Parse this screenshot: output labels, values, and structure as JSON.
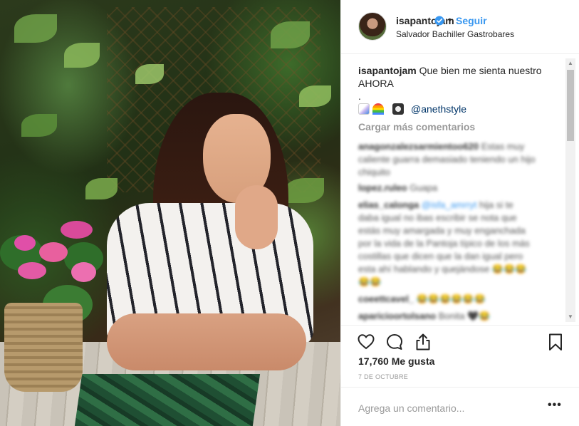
{
  "post": {
    "author": {
      "username": "isapantojam",
      "verified": true,
      "follow_separator": "•",
      "follow_label": "Seguir",
      "location": "Salvador Bachiller Gastrobares"
    },
    "caption": {
      "username": "isapantojam",
      "text": "Que bien me sienta nuestro AHORA",
      "dot": ".",
      "emoji_line": [
        "unicorn-emoji",
        "rainbow-emoji",
        "camera-emoji"
      ],
      "mention": "@anethstyle"
    },
    "load_more_label": "Cargar más comentarios",
    "comments": [
      {
        "user": "anagonzalezsarmientoo620",
        "text": "Estas muy caliente guarra demasiado teniendo un hijo chiquito"
      },
      {
        "user": "lopez.ruleo",
        "text": "Guapa"
      },
      {
        "user": "elias_calonga",
        "mention": "@isfa_amrryt",
        "text": "hija si te daba igual no ibas escribir se nota que estás muy amargada y muy enganchada por la vida de la Pantoja típico de los más costillas que dicen que la dan igual pero esta ahí hablando y quejándose 😂😂😂 😂😂"
      },
      {
        "user": "coeettcavel_",
        "text": "😂😂😂😂😂😂"
      },
      {
        "user": "aparicioortolsano",
        "text": "Bonita 🖤😂"
      }
    ],
    "likes_label": "17,760 Me gusta",
    "date_label": "7 DE OCTUBRE",
    "add_comment_placeholder": "Agrega un comentario...",
    "more_options_label": "•••"
  },
  "icons": {
    "like": "heart-icon",
    "comment": "comment-icon",
    "share": "share-icon",
    "save": "bookmark-icon"
  },
  "colors": {
    "link": "#3897f0",
    "verified": "#3897f0",
    "muted": "#999999"
  }
}
